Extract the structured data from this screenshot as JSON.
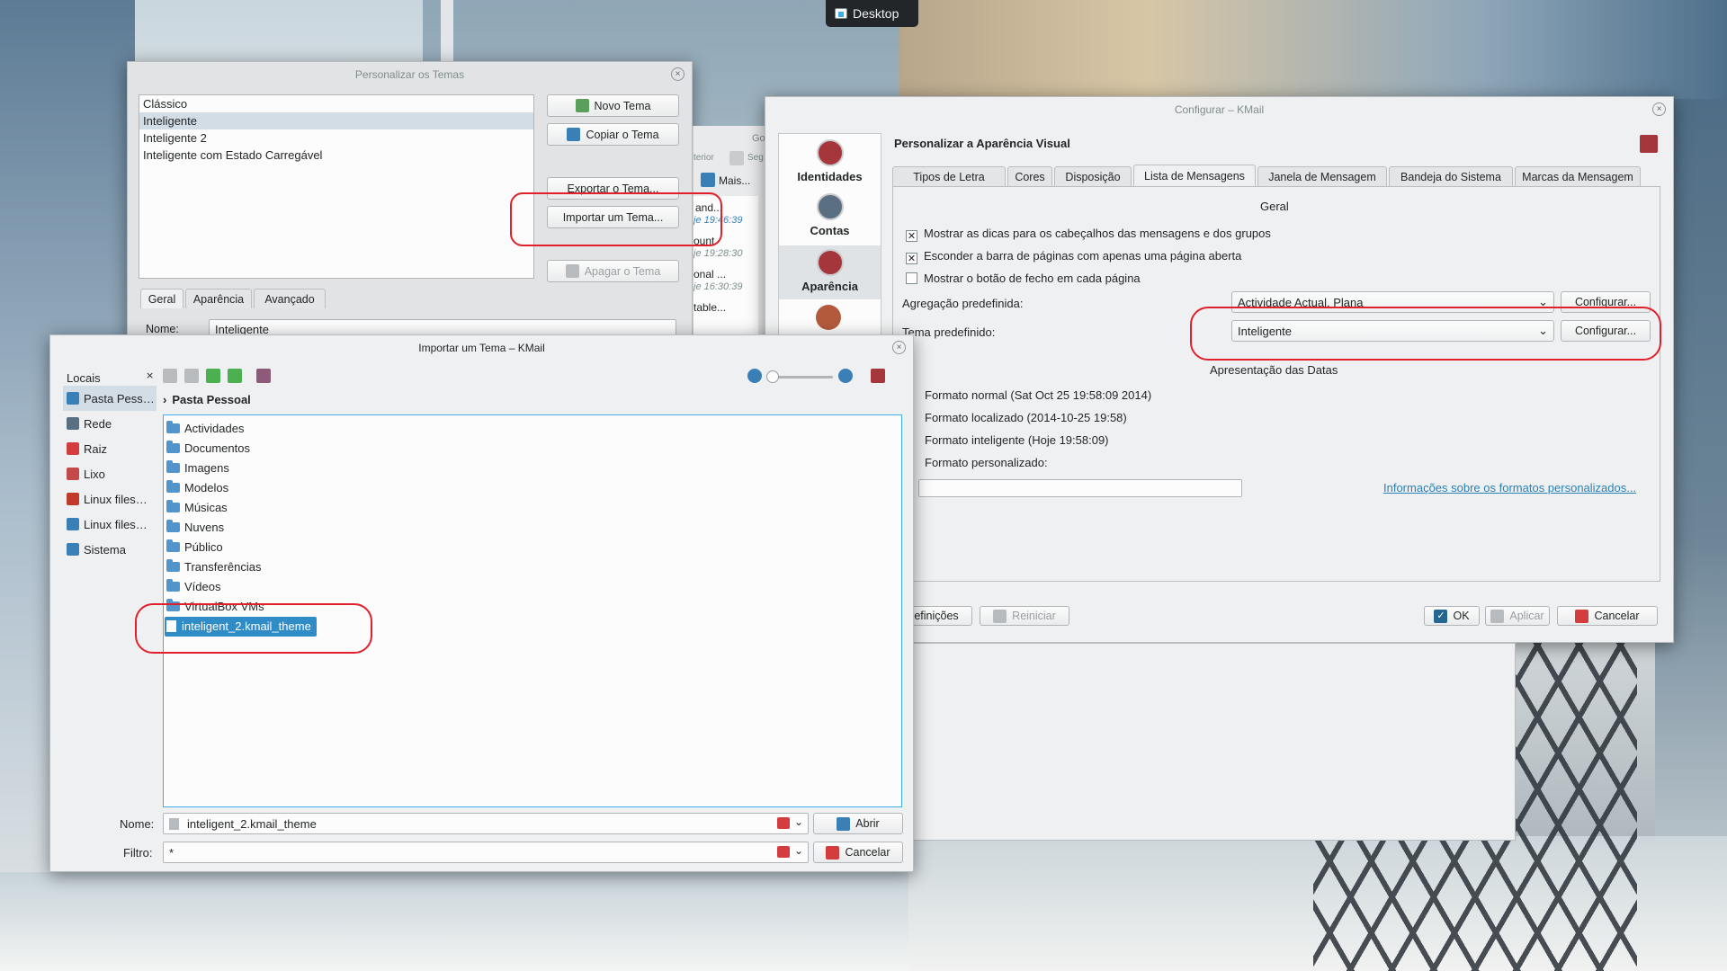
{
  "taskbar": {
    "label": "Desktop"
  },
  "themes_window": {
    "title": "Personalizar os Temas",
    "themes": [
      "Clássico",
      "Inteligente",
      "Inteligente 2",
      "Inteligente com Estado Carregável"
    ],
    "buttons": {
      "new": "Novo Tema",
      "copy": "Copiar o Tema",
      "export": "Exportar o Tema...",
      "import": "Importar um Tema...",
      "delete": "Apagar o Tema"
    },
    "tabs": [
      "Geral",
      "Aparência",
      "Avançado"
    ],
    "name_label": "Nome:",
    "name_value": "Inteligente"
  },
  "bg_kmail": {
    "fragments": [
      "Go",
      "terior",
      "Seg",
      "Mais...",
      "and...",
      "je 19:46:39",
      "ount",
      "je 19:28:30",
      "onal ...",
      "je 16:30:39",
      "table..."
    ]
  },
  "config_window": {
    "title": "Configurar – KMail",
    "heading": "Personalizar a Aparência Visual",
    "sidebar": [
      "Identidades",
      "Contas",
      "Aparência"
    ],
    "tabs": [
      "Tipos de Letra",
      "Cores",
      "Disposição",
      "Lista de Mensagens",
      "Janela de Mensagem",
      "Bandeja do Sistema",
      "Marcas da Mensagem"
    ],
    "general_heading": "Geral",
    "checks": [
      {
        "label": "Mostrar as dicas para os cabeçalhos das mensagens e dos grupos",
        "checked": true
      },
      {
        "label": "Esconder a barra de páginas com apenas uma página aberta",
        "checked": true
      },
      {
        "label": "Mostrar o botão de fecho em cada página",
        "checked": false
      }
    ],
    "aggregation_label": "Agregação predefinida:",
    "aggregation_value": "Actividade Actual, Plana",
    "theme_label": "Tema predefinido:",
    "theme_value": "Inteligente",
    "configure": "Configurar...",
    "dates_heading": "Apresentação das Datas",
    "date_formats": [
      "Formato normal (Sat Oct 25 19:58:09 2014)",
      "Formato localizado (2014-10-25 19:58)",
      "Formato inteligente (Hoje 19:58:09)",
      "Formato personalizado:"
    ],
    "custom_link": "Informações sobre os formatos personalizados...",
    "footer": {
      "defaults": "efinições",
      "reset": "Reiniciar",
      "ok": "OK",
      "apply": "Aplicar",
      "cancel": "Cancelar"
    }
  },
  "import_dialog": {
    "title": "Importar um Tema – KMail",
    "places_title": "Locais",
    "places": [
      "Pasta Pess…",
      "Rede",
      "Raiz",
      "Lixo",
      "Linux files…",
      "Linux files…",
      "Sistema"
    ],
    "breadcrumb": "Pasta Pessoal",
    "folders": [
      "Actividades",
      "Documentos",
      "Imagens",
      "Modelos",
      "Músicas",
      "Nuvens",
      "Público",
      "Transferências",
      "Vídeos",
      "VirtualBox VMs"
    ],
    "selected_file": "inteligent_2.kmail_theme",
    "name_label": "Nome:",
    "name_value": "inteligent_2.kmail_theme",
    "filter_label": "Filtro:",
    "filter_value": "*",
    "open": "Abrir",
    "cancel": "Cancelar"
  },
  "colors": {
    "accent": "#3daee9",
    "selection": "#308cc6",
    "annotation": "#e0202a"
  }
}
